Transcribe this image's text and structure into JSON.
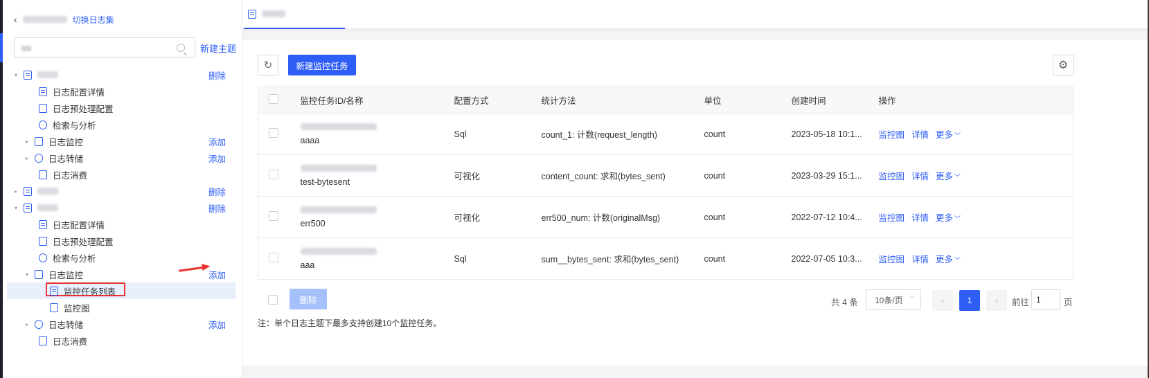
{
  "sidebar": {
    "switch_label": "切换日志集",
    "search_placeholder": "",
    "new_topic_label": "新建主题",
    "tree": [
      {
        "label": "",
        "action": "删除",
        "caret": "▾"
      },
      {
        "label": "日志配置详情",
        "action": ""
      },
      {
        "label": "日志预处理配置",
        "action": ""
      },
      {
        "label": "检索与分析",
        "action": ""
      },
      {
        "label": "日志监控",
        "action": "添加",
        "caret": "▸"
      },
      {
        "label": "日志转储",
        "action": "添加",
        "caret": "▸"
      },
      {
        "label": "日志消费",
        "action": ""
      },
      {
        "label": "",
        "action": "删除",
        "caret": "▸"
      },
      {
        "label": "",
        "action": "删除",
        "caret": "▾"
      },
      {
        "label": "日志配置详情",
        "action": ""
      },
      {
        "label": "日志预处理配置",
        "action": ""
      },
      {
        "label": "检索与分析",
        "action": ""
      },
      {
        "label": "日志监控",
        "action": "添加",
        "caret": "▾"
      },
      {
        "label": "监控任务列表",
        "action": ""
      },
      {
        "label": "监控图",
        "action": ""
      },
      {
        "label": "日志转储",
        "action": "添加",
        "caret": "▸"
      },
      {
        "label": "日志消费",
        "action": ""
      }
    ]
  },
  "toolbar": {
    "new_task_label": "新建监控任务",
    "refresh_icon": "↻",
    "settings_icon": "⚙"
  },
  "table": {
    "headers": [
      "监控任务ID/名称",
      "配置方式",
      "统计方法",
      "单位",
      "创建时间",
      "操作"
    ],
    "rows": [
      {
        "name": "aaaa",
        "mode": "Sql",
        "method": "count_1: 计数(request_length)",
        "unit": "count",
        "created": "2023-05-18 10:1..."
      },
      {
        "name": "test-bytesent",
        "mode": "可视化",
        "method": "content_count: 求和(bytes_sent)",
        "unit": "count",
        "created": "2023-03-29 15:1..."
      },
      {
        "name": "err500",
        "mode": "可视化",
        "method": "err500_num: 计数(originalMsg)",
        "unit": "count",
        "created": "2022-07-12 10:4..."
      },
      {
        "name": "aaa",
        "mode": "Sql",
        "method": "sum__bytes_sent: 求和(bytes_sent)",
        "unit": "count",
        "created": "2022-07-05 10:3..."
      }
    ],
    "ops": {
      "chart": "监控图",
      "detail": "详情",
      "more": "更多"
    }
  },
  "footer": {
    "delete_label": "删除",
    "total_text": "共 4 条",
    "page_size": "10条/页",
    "current_page": "1",
    "goto_label": "前往",
    "goto_value": "1",
    "page_word": "页",
    "note": "注：单个日志主题下最多支持创建10个监控任务。"
  },
  "colors": {
    "accent": "#2e5ef6",
    "annotation": "#e7322f"
  }
}
